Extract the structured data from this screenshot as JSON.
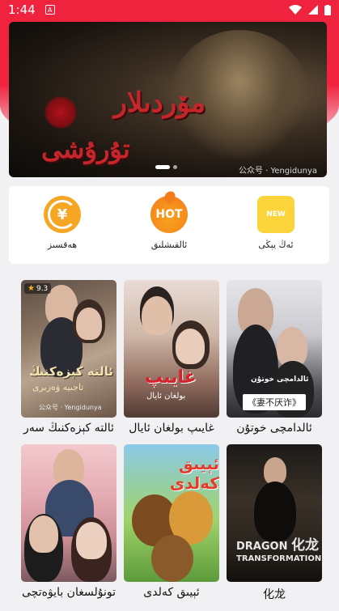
{
  "statusbar": {
    "time": "1:44",
    "notif_icon": "A"
  },
  "banner": {
    "title_line1": "مۆردىلار",
    "title_line2": "تۇرۇشى",
    "watermark": "公众号 · Yengidunya",
    "slide_index": 1,
    "slide_count": 2
  },
  "shortcuts": [
    {
      "label": "ھەقسىز",
      "icon": "yuan-icon",
      "glyph": "¥"
    },
    {
      "label": "ئالقىشلىق",
      "icon": "hot-icon",
      "glyph": "HOT"
    },
    {
      "label": "ئەڭ يېڭى",
      "icon": "new-icon",
      "glyph": "NEW"
    }
  ],
  "dramas": [
    {
      "title": "ئالدامچى خوتۇن",
      "poster_text": "ئالدامچى خوتۇن",
      "poster_quote": "《妻不厌诈》"
    },
    {
      "title": "غايىپ بولغان ئايال",
      "poster_text": "غايىپ",
      "poster_sub": "بولغان ئايال"
    },
    {
      "title": "ئالتە كېزەكنىڭ سەر",
      "rating": "9.3",
      "poster_text": "ئالتە كېزەكنىڭ",
      "poster_sub": "تاجىيە ۋەزىرى",
      "watermark": "公众号 · Yengidunya"
    },
    {
      "title": "化龙",
      "poster_text": "DRAGON",
      "poster_sub": "TRANSFORMATION",
      "poster_cn": "化龙"
    },
    {
      "title": "ئېيىق كەلدى",
      "poster_text": "ئېيىق كەلدى"
    },
    {
      "title": "تونۇلسغان بايۋەتچى"
    }
  ],
  "colors": {
    "accent": "#f0233f",
    "hot": "#f47c1a",
    "yuan": "#f5a623",
    "new": "#fbd43b"
  }
}
